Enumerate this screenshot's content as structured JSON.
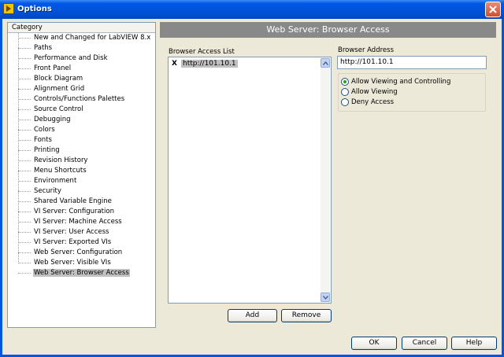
{
  "window": {
    "title": "Options"
  },
  "category": {
    "header": "Category",
    "items": [
      "New and Changed for LabVIEW 8.x",
      "Paths",
      "Performance and Disk",
      "Front Panel",
      "Block Diagram",
      "Alignment Grid",
      "Controls/Functions Palettes",
      "Source Control",
      "Debugging",
      "Colors",
      "Fonts",
      "Printing",
      "Revision History",
      "Menu Shortcuts",
      "Environment",
      "Security",
      "Shared Variable Engine",
      "VI Server: Configuration",
      "VI Server: Machine Access",
      "VI Server: User Access",
      "VI Server: Exported VIs",
      "Web Server: Configuration",
      "Web Server: Visible VIs",
      "Web Server: Browser Access"
    ],
    "selected": "Web Server: Browser Access"
  },
  "panel": {
    "title": "Web Server: Browser Access",
    "access_list_label": "Browser Access List",
    "access_list": [
      {
        "marker": "X",
        "value": "http://101.10.1"
      }
    ],
    "address_label": "Browser Address",
    "address_value": "http://101.10.1",
    "options": [
      {
        "label": "Allow Viewing and Controlling",
        "checked": true
      },
      {
        "label": "Allow Viewing",
        "checked": false
      },
      {
        "label": "Deny Access",
        "checked": false
      }
    ],
    "add_label": "Add",
    "remove_label": "Remove"
  },
  "footer": {
    "ok": "OK",
    "cancel": "Cancel",
    "help": "Help"
  },
  "colors": {
    "titlebar": "#0054e3",
    "banner": "#898989",
    "dialog": "#ece9d8"
  },
  "icons": {
    "app": "labview-icon",
    "close": "close-icon"
  }
}
